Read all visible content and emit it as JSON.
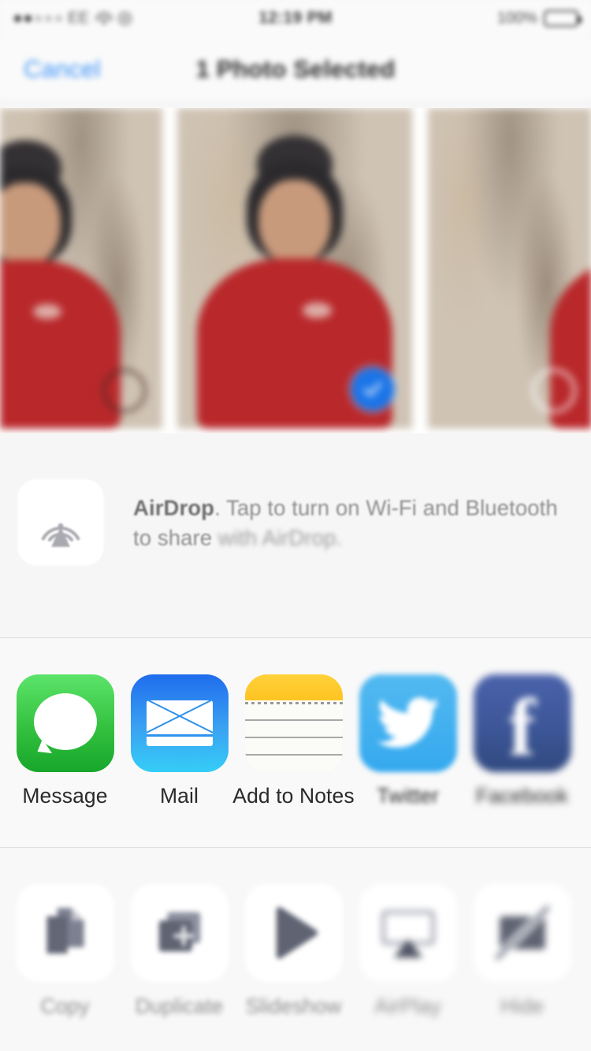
{
  "status_bar": {
    "carrier": "EE",
    "signal_dots": [
      true,
      true,
      false,
      false,
      false
    ],
    "wifi_icon": "wifi-icon",
    "rotation_lock_icon": "rotation-lock-icon",
    "time": "12:19 PM",
    "battery_percent": "100%",
    "battery_icon": "battery-full-icon"
  },
  "nav_bar": {
    "cancel_label": "Cancel",
    "title": "1 Photo Selected"
  },
  "photos": [
    {
      "name": "photo-thumbnail-previous",
      "selected": false,
      "description": "Person in red sweater against brick wall"
    },
    {
      "name": "photo-thumbnail-selected",
      "selected": true,
      "description": "Person in red sweater against brick wall"
    },
    {
      "name": "photo-thumbnail-next",
      "selected": false,
      "description": "Person in red sweater against brick wall"
    }
  ],
  "airdrop": {
    "icon": "airdrop-icon",
    "title": "AirDrop",
    "message_rest": ". Tap to turn on Wi-Fi and Bluetooth to share",
    "message_line2": "with AirDrop."
  },
  "share_apps": [
    {
      "name": "share-app-message",
      "label": "Message",
      "icon": "messages-icon",
      "color": "#34c13f"
    },
    {
      "name": "share-app-mail",
      "label": "Mail",
      "icon": "mail-icon",
      "color": "#3aa2f2"
    },
    {
      "name": "share-app-notes",
      "label": "Add to Notes",
      "icon": "notes-icon",
      "color": "#fec421"
    },
    {
      "name": "share-app-twitter",
      "label": "Twitter",
      "icon": "twitter-icon",
      "color": "#35a9ef"
    },
    {
      "name": "share-app-facebook",
      "label": "Facebook",
      "icon": "facebook-icon",
      "color": "#3b5595"
    }
  ],
  "actions": [
    {
      "name": "action-copy",
      "label": "Copy",
      "icon": "copy-icon"
    },
    {
      "name": "action-duplicate",
      "label": "Duplicate",
      "icon": "duplicate-icon"
    },
    {
      "name": "action-slideshow",
      "label": "Slideshow",
      "icon": "play-icon"
    },
    {
      "name": "action-airplay",
      "label": "AirPlay",
      "icon": "airplay-icon"
    },
    {
      "name": "action-hide",
      "label": "Hide",
      "icon": "hide-icon"
    }
  ],
  "colors": {
    "accent_blue": "#3b92f7",
    "selection_badge": "#1a74e8",
    "background": "#f7f7f7",
    "divider": "#dedede"
  }
}
